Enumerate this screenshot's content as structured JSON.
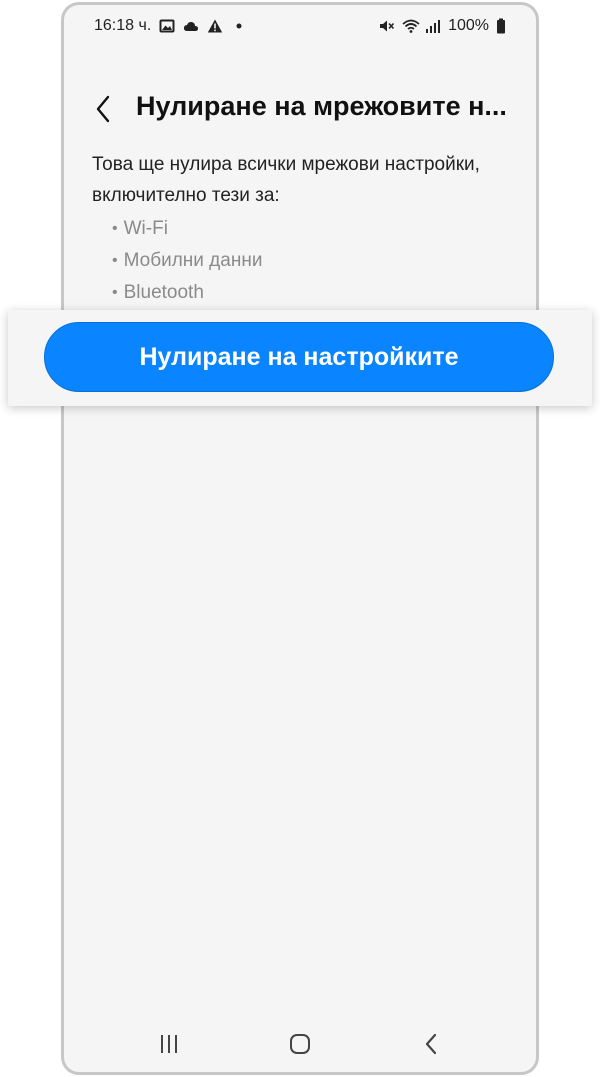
{
  "status_bar": {
    "time": "16:18 ч.",
    "battery": "100%",
    "left_icons": [
      "image-icon",
      "cloud-icon",
      "warning-icon",
      "dot-icon"
    ],
    "right_icons": [
      "mute-icon",
      "wifi-icon",
      "signal-icon",
      "battery-icon"
    ]
  },
  "header": {
    "title": "Нулиране на мрежовите н..."
  },
  "content": {
    "description": "Това ще нулира всички мрежови настройки, включително тези за:",
    "bullets": [
      "Wi-Fi",
      "Мобилни данни",
      "Bluetooth"
    ]
  },
  "action": {
    "reset_label": "Нулиране на настройките",
    "accent_color": "#0a84ff"
  },
  "nav_bar": {
    "buttons": [
      "recent-apps-icon",
      "home-icon",
      "back-icon"
    ]
  }
}
